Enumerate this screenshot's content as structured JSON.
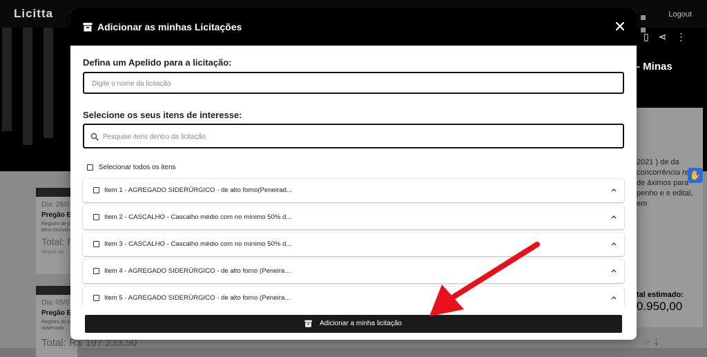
{
  "background": {
    "logo": "Licitta",
    "logout_label": "Logout",
    "right_title": "- Minas",
    "right_text": "2021 ) de da concorrência resas de áximos para penho e e edital, em",
    "total_label": "tal estimado:",
    "total_value": "0.950,00",
    "cards": [
      {
        "date": "Dia: 28/0",
        "type": "Pregão E",
        "desc": "Registro de p itens exclusiv",
        "total": "Total: R",
        "extra": "Registr ab"
      },
      {
        "date": "Dia: 05/0",
        "type": "Pregão E",
        "desc": "Registro de p observado",
        "total": "",
        "extra": ""
      }
    ],
    "price": "Total: R$ 197.233,50"
  },
  "modal": {
    "title": "Adicionar as minhas Licitações",
    "nickname_label": "Defina um Apelido para a licitação:",
    "nickname_placeholder": "Digite o nome da licitação",
    "items_label": "Selecione os seus itens de interesse:",
    "search_placeholder": "Pesquise itens dentro da licitação",
    "select_all_label": "Selecionar todos os itens",
    "items": [
      {
        "label": "Item 1 - AGREGADO SIDERÚRGICO - de alto forno(Peneirad..."
      },
      {
        "label": "Item 2 - CASCALHO - Cascalho médio com no mínimo 50% d..."
      },
      {
        "label": "Item 3 - CASCALHO - Cascalho médio com no mínimo 50% d..."
      },
      {
        "label": "Item 4 - AGREGADO SIDERÚRGICO - de alto forno (Peneira..."
      },
      {
        "label": "Item 5 - AGREGADO SIDERÚRGICO - de alto forno (Peneira..."
      }
    ],
    "submit_label": "Adicionar a minha licitação"
  },
  "colors": {
    "header": "#000000",
    "button": "#1a1a1a",
    "arrow": "#e8111a",
    "accessibility": "#2b6de0"
  }
}
